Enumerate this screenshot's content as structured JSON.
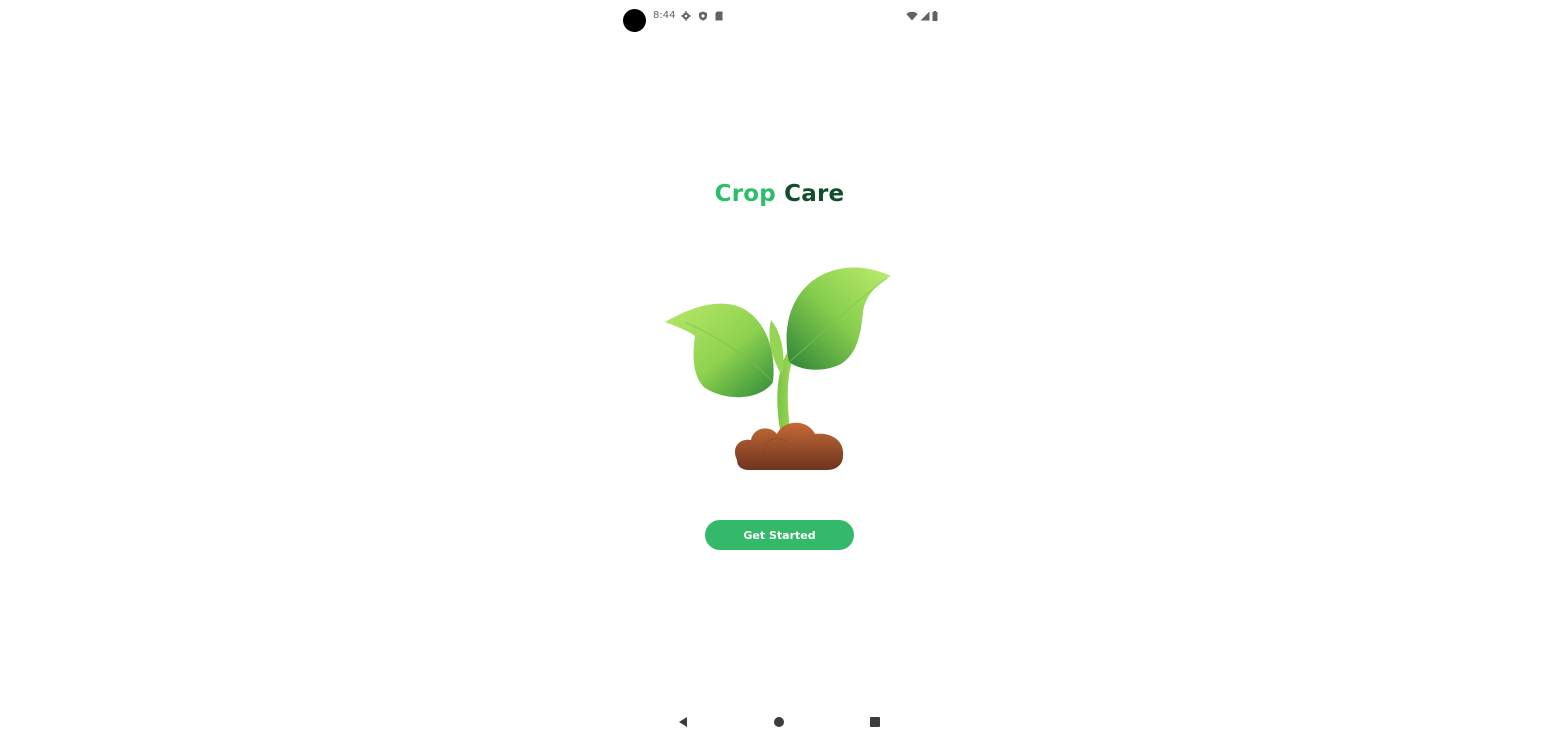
{
  "status_bar": {
    "time": "8:44",
    "icons": [
      "settings-icon",
      "shield-icon",
      "sd-card-icon",
      "wifi-icon",
      "signal-icon",
      "battery-icon"
    ]
  },
  "title": {
    "part1": "Crop",
    "part2": "Care",
    "colors": {
      "part1": "#2ebd68",
      "part2": "#124d2c"
    }
  },
  "illustration": {
    "name": "seedling-illustration"
  },
  "cta": {
    "label": "Get Started",
    "color": "#34b96b"
  },
  "nav_bar": {
    "buttons": [
      "back-icon",
      "home-icon",
      "recents-icon"
    ]
  }
}
